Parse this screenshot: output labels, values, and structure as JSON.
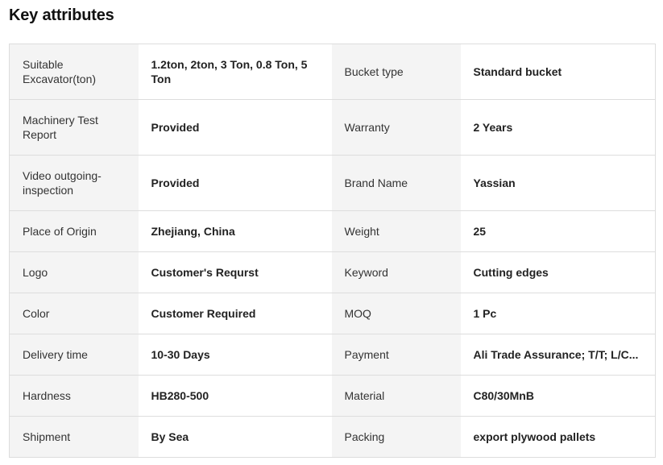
{
  "heading": "Key attributes",
  "rows": [
    {
      "label1": "Suitable Excavator(ton)",
      "value1": "1.2ton, 2ton, 3 Ton, 0.8 Ton, 5 Ton",
      "label2": "Bucket type",
      "value2": "Standard bucket"
    },
    {
      "label1": "Machinery Test Report",
      "value1": "Provided",
      "label2": "Warranty",
      "value2": "2 Years"
    },
    {
      "label1": "Video outgoing-inspection",
      "value1": "Provided",
      "label2": "Brand Name",
      "value2": "Yassian"
    },
    {
      "label1": "Place of Origin",
      "value1": "Zhejiang, China",
      "label2": "Weight",
      "value2": "25"
    },
    {
      "label1": "Logo",
      "value1": "Customer's Requrst",
      "label2": "Keyword",
      "value2": "Cutting edges"
    },
    {
      "label1": "Color",
      "value1": "Customer Required",
      "label2": "MOQ",
      "value2": "1 Pc"
    },
    {
      "label1": "Delivery time",
      "value1": "10-30 Days",
      "label2": "Payment",
      "value2": "Ali Trade Assurance; T/T; L/C..."
    },
    {
      "label1": "Hardness",
      "value1": "HB280-500",
      "label2": "Material",
      "value2": "C80/30MnB"
    },
    {
      "label1": "Shipment",
      "value1": "By Sea",
      "label2": "Packing",
      "value2": "export plywood pallets"
    }
  ]
}
